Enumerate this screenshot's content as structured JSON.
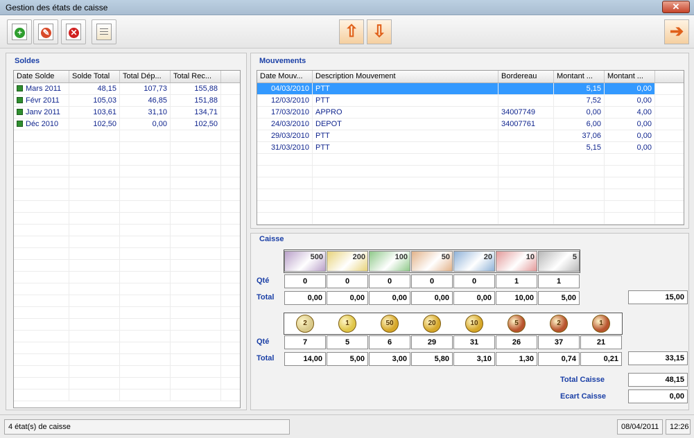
{
  "window": {
    "title": "Gestion des états de caisse",
    "close_label": "✕"
  },
  "toolbar": {
    "add_icon": "add-icon",
    "edit_icon": "edit-icon",
    "delete_icon": "delete-icon",
    "report_icon": "report-icon",
    "import_icon": "arrow-up-icon",
    "export_icon": "arrow-down-icon",
    "exit_icon": "exit-arrow-icon"
  },
  "soldes": {
    "title": "Soldes",
    "columns": [
      "Date Solde",
      "Solde Total",
      "Total Dép...",
      "Total Rec..."
    ],
    "rows": [
      [
        "Mars 2011",
        "48,15",
        "107,73",
        "155,88"
      ],
      [
        "Févr 2011",
        "105,03",
        "46,85",
        "151,88"
      ],
      [
        "Janv 2011",
        "103,61",
        "31,10",
        "134,71"
      ],
      [
        "Déc 2010",
        "102,50",
        "0,00",
        "102,50"
      ]
    ]
  },
  "mouvements": {
    "title": "Mouvements",
    "columns": [
      "Date Mouv...",
      "Description Mouvement",
      "Bordereau",
      "Montant ...",
      "Montant ..."
    ],
    "rows": [
      [
        "04/03/2010",
        "PTT",
        "",
        "5,15",
        "0,00"
      ],
      [
        "12/03/2010",
        "PTT",
        "",
        "7,52",
        "0,00"
      ],
      [
        "17/03/2010",
        "APPRO",
        "34007749",
        "0,00",
        "4,00"
      ],
      [
        "24/03/2010",
        "DEPOT",
        "34007761",
        "6,00",
        "0,00"
      ],
      [
        "29/03/2010",
        "PTT",
        "",
        "37,06",
        "0,00"
      ],
      [
        "31/03/2010",
        "PTT",
        "",
        "5,15",
        "0,00"
      ]
    ]
  },
  "caisse": {
    "title": "Caisse",
    "qte_label": "Qté",
    "total_label": "Total",
    "notes": {
      "denominations": [
        "500",
        "200",
        "100",
        "50",
        "20",
        "10",
        "5"
      ],
      "colors": [
        "#b9a0c9",
        "#e8d37a",
        "#8fc98a",
        "#e3b38a",
        "#8fb2d8",
        "#e39a9a",
        "#b8b8b8"
      ],
      "qte": [
        "0",
        "0",
        "0",
        "0",
        "0",
        "1",
        "1"
      ],
      "totals": [
        "0,00",
        "0,00",
        "0,00",
        "0,00",
        "0,00",
        "10,00",
        "5,00"
      ],
      "grand_total": "15,00"
    },
    "coins": {
      "labels": [
        "2",
        "1",
        "50",
        "20",
        "10",
        "5",
        "2",
        "1"
      ],
      "colors": [
        "#d9c98a",
        "#e0c64a",
        "#d6a72a",
        "#d6a72a",
        "#d6a72a",
        "#b8542e",
        "#b8542e",
        "#b8542e"
      ],
      "qte": [
        "7",
        "5",
        "6",
        "29",
        "31",
        "26",
        "37",
        "21"
      ],
      "totals": [
        "14,00",
        "5,00",
        "3,00",
        "5,80",
        "3,10",
        "1,30",
        "0,74",
        "0,21"
      ],
      "grand_total": "33,15"
    },
    "total_caisse_label": "Total Caisse",
    "total_caisse": "48,15",
    "ecart_caisse_label": "Ecart Caisse",
    "ecart_caisse": "0,00"
  },
  "status": {
    "count": "4 état(s) de caisse",
    "date": "08/04/2011",
    "time": "12:26"
  }
}
